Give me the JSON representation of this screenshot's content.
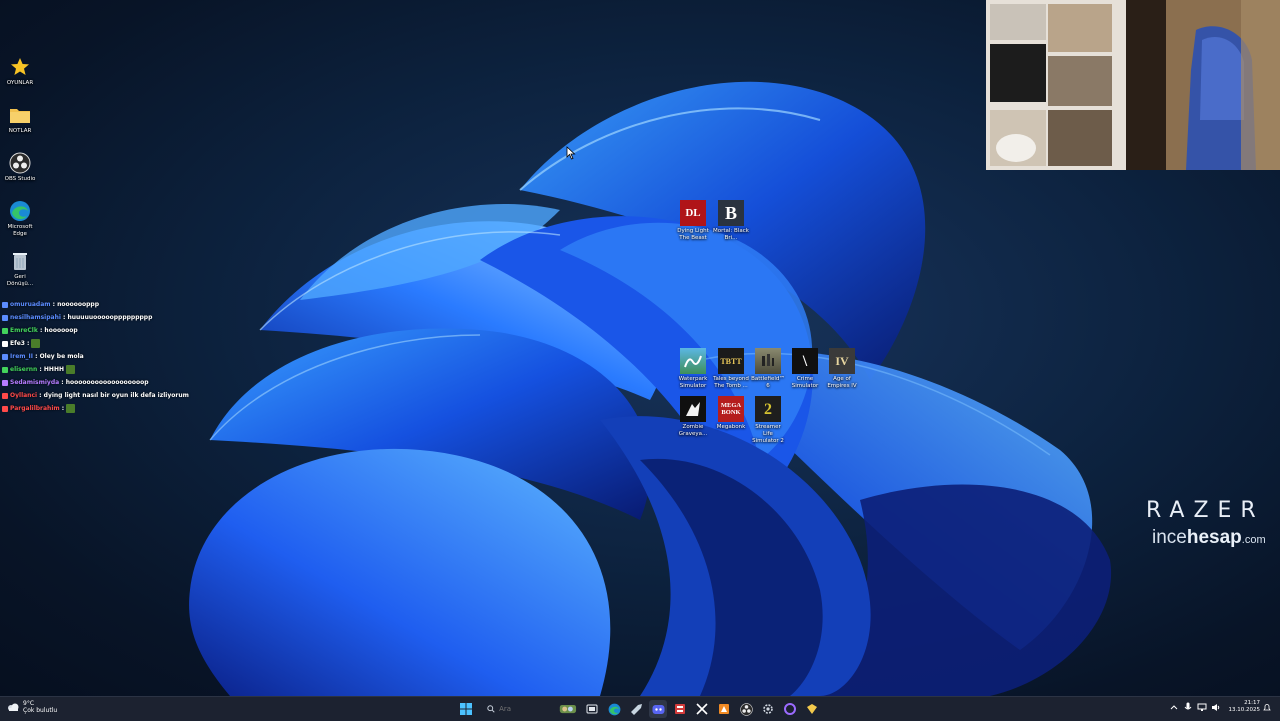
{
  "desktop_icons": [
    {
      "label": "OYUNLAR",
      "icon": "star-icon"
    },
    {
      "label": "NOTLAR",
      "icon": "folder-icon"
    },
    {
      "label": "OBS Studio",
      "icon": "obs-icon"
    },
    {
      "label": "Microsoft Edge",
      "icon": "edge-icon"
    },
    {
      "label": "Geri Dönüşü...",
      "icon": "recycle-bin-icon"
    }
  ],
  "game_icons": [
    {
      "label": "Dying Light The Beast",
      "glyph": "DL",
      "color": "#b01418"
    },
    {
      "label": "Mortal: Black Bri...",
      "glyph": "B",
      "color": "#2a3340"
    },
    {
      "label": "Waterpark Simulator",
      "glyph": "",
      "color": "#3f8f5a"
    },
    {
      "label": "Tales beyond The Tomb ...",
      "glyph": "TBTT",
      "color": "#1b1b1b"
    },
    {
      "label": "Battlefield™ 6",
      "glyph": "",
      "color": "#6b6a55"
    },
    {
      "label": "Crime Simulator",
      "glyph": "\\",
      "color": "#101010"
    },
    {
      "label": "Age of Empires IV",
      "glyph": "IV",
      "color": "#3a3a3a"
    },
    {
      "label": "Zombie Graveya...",
      "glyph": "",
      "color": "#f2f2f2"
    },
    {
      "label": "Megabonk",
      "glyph": "MEGA BONK",
      "color": "#b51d1d"
    },
    {
      "label": "Streamer Life Simulator 2",
      "glyph": "2",
      "color": "#d5c231"
    }
  ],
  "chat": [
    {
      "user": "omuruadam",
      "message": ": nooooooppp",
      "color": "#5b8cff",
      "emote": false
    },
    {
      "user": "nesilhamsipahi",
      "message": ": huuuuuoooooppppppppp",
      "color": "#5b8cff",
      "emote": false
    },
    {
      "user": "EmreClk",
      "message": ": hoooooop",
      "color": "#43d35c",
      "emote": false
    },
    {
      "user": "Efe3",
      "message": ":",
      "color": "#ffffff",
      "emote": true
    },
    {
      "user": "Irem_II",
      "message": ": Oley be mola",
      "color": "#5b8cff",
      "emote": false
    },
    {
      "user": "elisernn",
      "message": ":  HHHH",
      "color": "#43d35c",
      "emote": true
    },
    {
      "user": "Sedamismiyda",
      "message": ": hoooooooooooooooooop",
      "color": "#b67cff",
      "emote": false
    },
    {
      "user": "Oyllanci",
      "message": ": dying light nasıl bir oyun ilk defa izliyorum",
      "color": "#ff4a4a",
      "emote": false
    },
    {
      "user": "Pargalilbrahim",
      "message": ":",
      "color": "#ff4a4a",
      "emote": true
    }
  ],
  "brand": {
    "razer": "RAZER",
    "site_bold": "incehesap",
    "site_prefix": "ince",
    "site_main": "hesap",
    "site_suffix": ".com"
  },
  "taskbar": {
    "weather_temp": "9°C",
    "weather_desc": "Çok bulutlu",
    "search_placeholder": "Ara",
    "time": "21:17",
    "date": "13.10.2025"
  },
  "colors": {
    "taskbar": "#1c2230",
    "accent": "#0a74da"
  }
}
